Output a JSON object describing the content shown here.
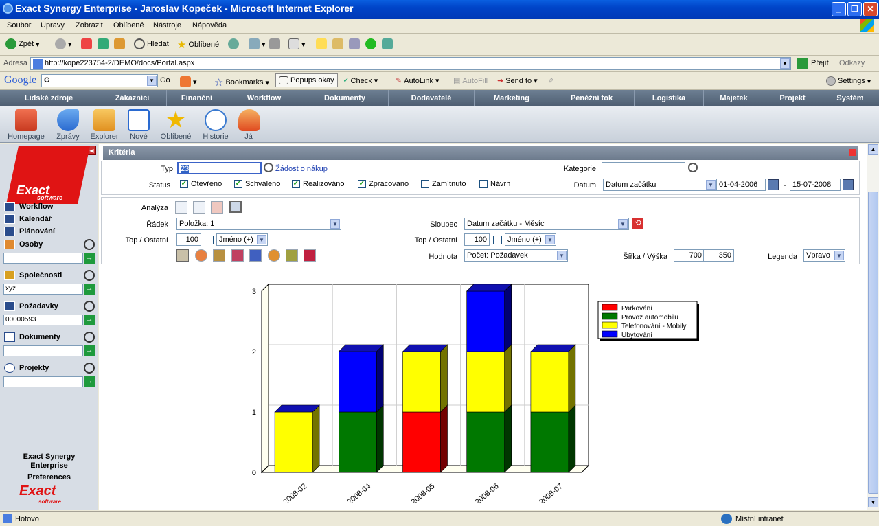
{
  "window": {
    "title": "Exact Synergy Enterprise - Jaroslav Kopeček - Microsoft Internet Explorer"
  },
  "menu": [
    "Soubor",
    "Úpravy",
    "Zobrazit",
    "Oblíbené",
    "Nástroje",
    "Nápověda"
  ],
  "toolbar": {
    "back": "Zpět",
    "search": "Hledat",
    "favorites": "Oblíbené"
  },
  "address": {
    "label": "Adresa",
    "url": "http://kope223754-2/DEMO/docs/Portal.aspx",
    "go": "Přejít",
    "links": "Odkazy"
  },
  "google": {
    "brand": "Google",
    "go": "Go",
    "bookmarks": "Bookmarks",
    "popups": "Popups okay",
    "check": "Check",
    "autolink": "AutoLink",
    "autofill": "AutoFill",
    "sendto": "Send to",
    "settings": "Settings"
  },
  "appnav": [
    "Lidské zdroje",
    "Zákazníci",
    "Finanční",
    "Workflow",
    "Dokumenty",
    "Dodavatelé",
    "Marketing",
    "Peněžní tok",
    "Logistika",
    "Majetek",
    "Projekt",
    "Systém"
  ],
  "icons": [
    "Homepage",
    "Zprávy",
    "Explorer",
    "Nové",
    "Oblíbené",
    "Historie",
    "Já"
  ],
  "sidebar": {
    "logo": "Exact",
    "logo_sub": "software",
    "links": [
      "Workflow",
      "Kalendář",
      "Plánování"
    ],
    "sections": [
      {
        "label": "Osoby",
        "value": ""
      },
      {
        "label": "Společnosti",
        "value": "xyz"
      },
      {
        "label": "Požadavky",
        "value": "00000593"
      },
      {
        "label": "Dokumenty",
        "value": ""
      },
      {
        "label": "Projekty",
        "value": ""
      }
    ],
    "footer1": "Exact Synergy",
    "footer2": "Enterprise",
    "footer3": "Preferences"
  },
  "criteria": {
    "header": "Kritéria",
    "typ_label": "Typ",
    "typ_value": "23",
    "typ_link": "Žádost o nákup",
    "status_label": "Status",
    "statuses": [
      {
        "label": "Otevřeno",
        "checked": true
      },
      {
        "label": "Schváleno",
        "checked": true
      },
      {
        "label": "Realizováno",
        "checked": true
      },
      {
        "label": "Zpracováno",
        "checked": true
      },
      {
        "label": "Zamítnuto",
        "checked": false
      },
      {
        "label": "Návrh",
        "checked": false
      }
    ],
    "kategorie_label": "Kategorie",
    "datum_label": "Datum",
    "datum_value": "Datum začátku",
    "date_from": "01-04-2006",
    "date_sep": "-",
    "date_to": "15-07-2008"
  },
  "analysis": {
    "analyza_label": "Analýza",
    "radek_label": "Řádek",
    "radek_value": "Položka: 1",
    "top_label": "Top / Ostatní",
    "top_value": "100",
    "top_sel": "Jméno (+)",
    "sloupec_label": "Sloupec",
    "sloupec_value": "Datum začátku - Měsíc",
    "top2_value": "100",
    "top2_sel": "Jméno (+)",
    "hodnota_label": "Hodnota",
    "hodnota_value": "Počet: Požadavek",
    "size_label": "Šířka / Výška",
    "width_value": "700",
    "height_value": "350",
    "legenda_label": "Legenda",
    "legenda_value": "Vpravo"
  },
  "chart_data": {
    "type": "bar",
    "stacked": true,
    "categories": [
      "2008-02",
      "2008-04",
      "2008-05",
      "2008-06",
      "2008-07"
    ],
    "series": [
      {
        "name": "Parkování",
        "color": "#ff0000",
        "values": [
          0,
          0,
          1,
          0,
          0
        ]
      },
      {
        "name": "Provoz automobilu",
        "color": "#007800",
        "values": [
          0,
          1,
          0,
          1,
          1
        ]
      },
      {
        "name": "Telefonování - Mobily",
        "color": "#ffff00",
        "values": [
          1,
          0,
          1,
          1,
          1
        ]
      },
      {
        "name": "Ubytování",
        "color": "#0000ff",
        "values": [
          0,
          1,
          0,
          1,
          0
        ]
      }
    ],
    "yticks": [
      "0",
      "1",
      "2",
      "3"
    ],
    "ylim": [
      0,
      3
    ],
    "legend": "right"
  },
  "status": {
    "text": "Hotovo",
    "zone": "Místní intranet"
  }
}
